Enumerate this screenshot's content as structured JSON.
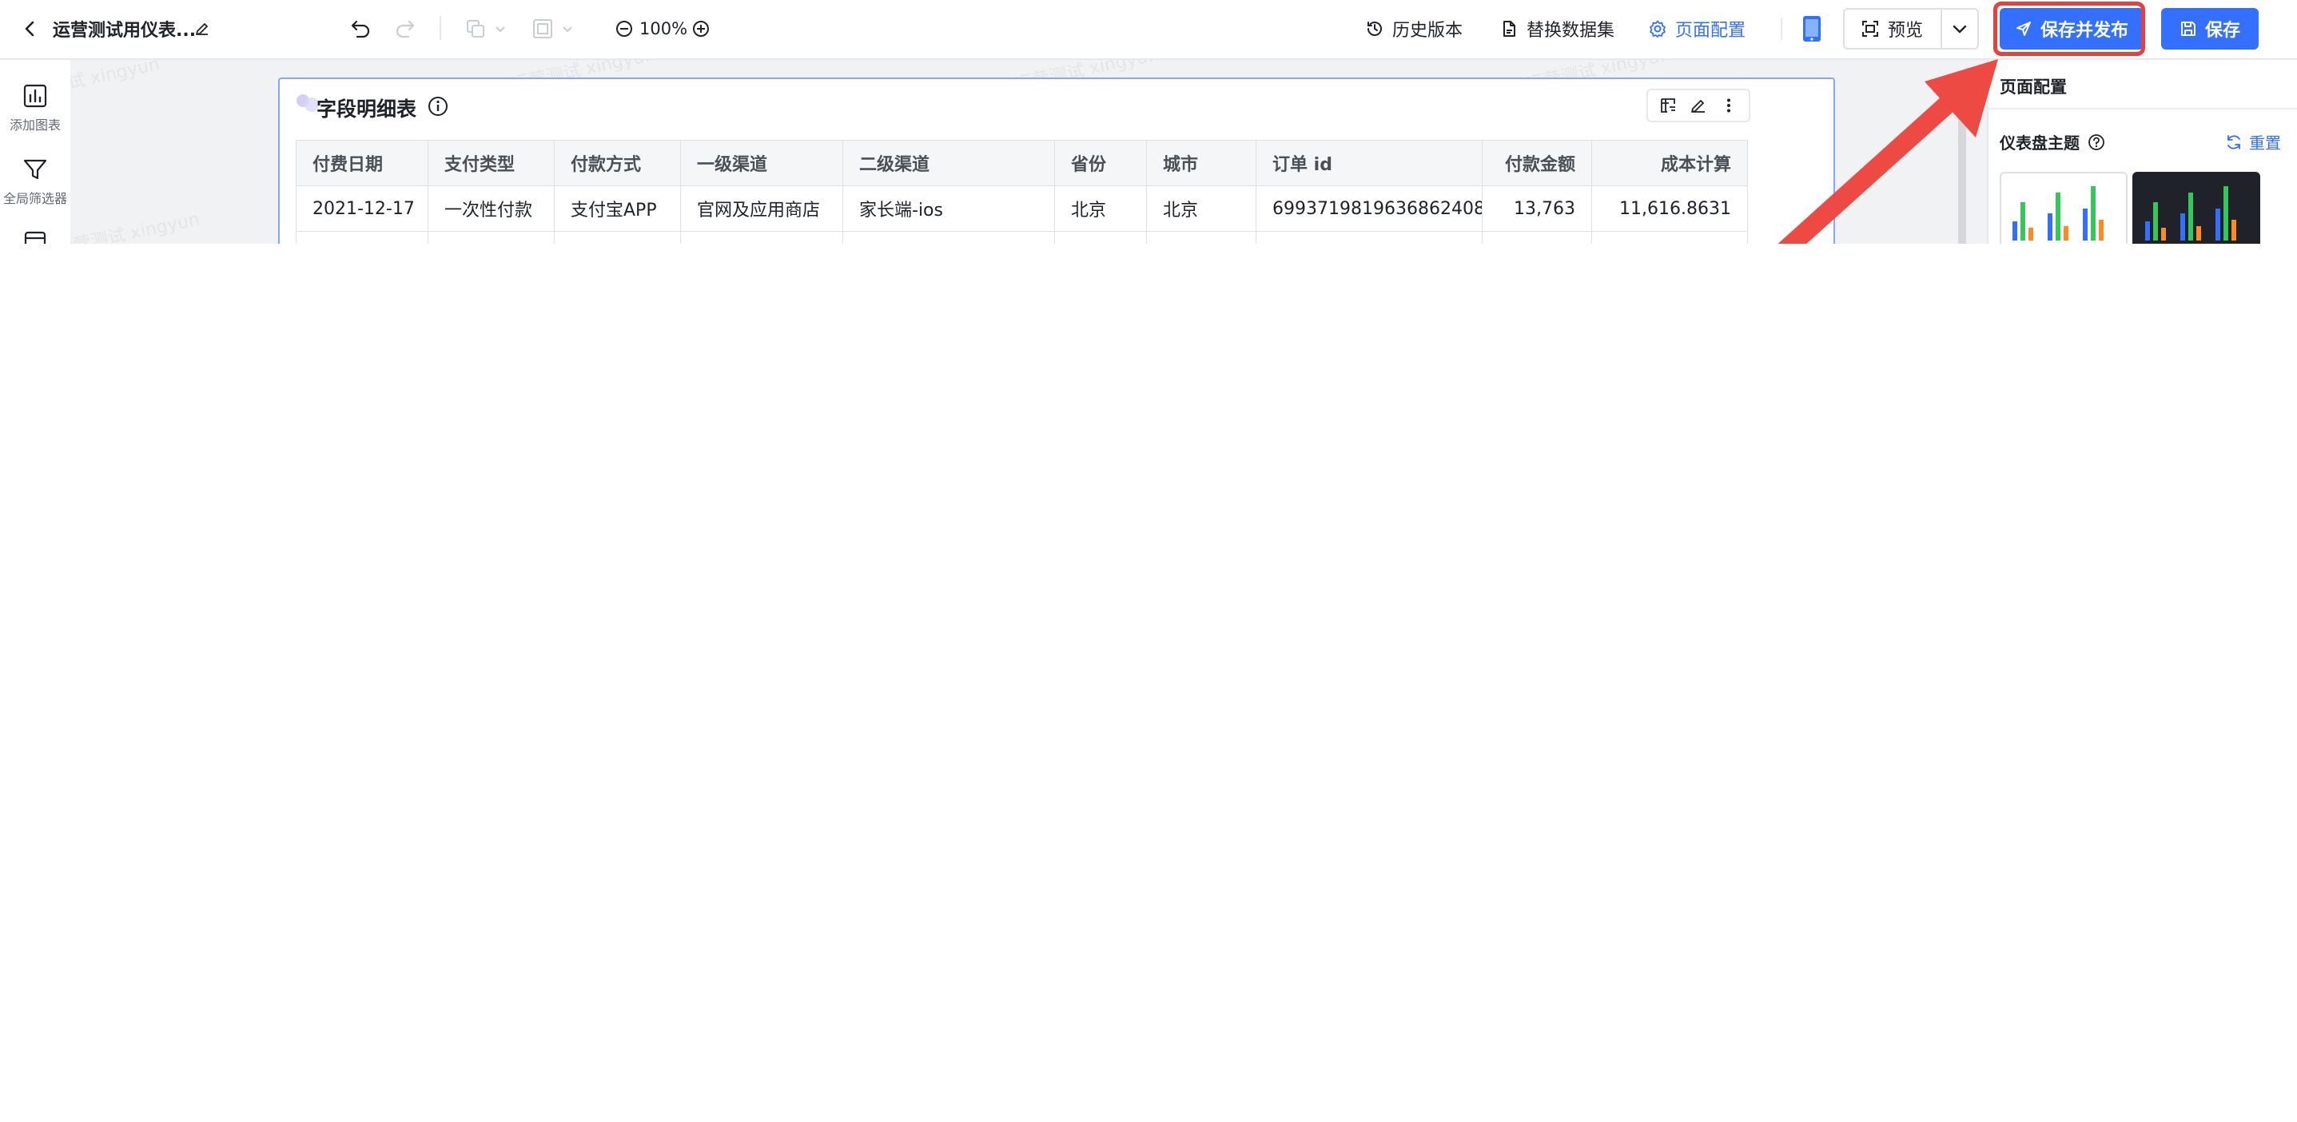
{
  "header": {
    "doc_title": "运营测试用仪表...",
    "zoom": "100%",
    "history": "历史版本",
    "replace_dataset": "替换数据集",
    "page_config": "页面配置",
    "preview": "预览",
    "save_publish": "保存并发布",
    "save": "保存"
  },
  "sidebar": {
    "items": [
      {
        "label": "添加图表",
        "icon": "bar-chart-icon"
      },
      {
        "label": "全局筛选器",
        "icon": "filter-icon"
      },
      {
        "label": "",
        "icon": "calendar-icon"
      }
    ]
  },
  "widget": {
    "title": "字段明细表",
    "columns": [
      "付费日期",
      "支付类型",
      "付款方式",
      "一级渠道",
      "二级渠道",
      "省份",
      "城市",
      "订单 id",
      "付款金额",
      "成本计算"
    ],
    "rows": [
      [
        "2021-12-17",
        "一次性付款",
        "支付宝APP",
        "官网及应用商店",
        "家长端-ios",
        "北京",
        "北京",
        "6993719819636862408",
        "13,763",
        "11,616.8631"
      ]
    ]
  },
  "watermark": "运营测试 xingyun",
  "right_panel": {
    "title": "页面配置",
    "theme_label": "仪表盘主题",
    "reset": "重置"
  },
  "colors": {
    "accent": "#3370ff",
    "highlight": "#e8403a",
    "series": [
      "#3370ff",
      "#34c759",
      "#ff8a1f"
    ]
  }
}
